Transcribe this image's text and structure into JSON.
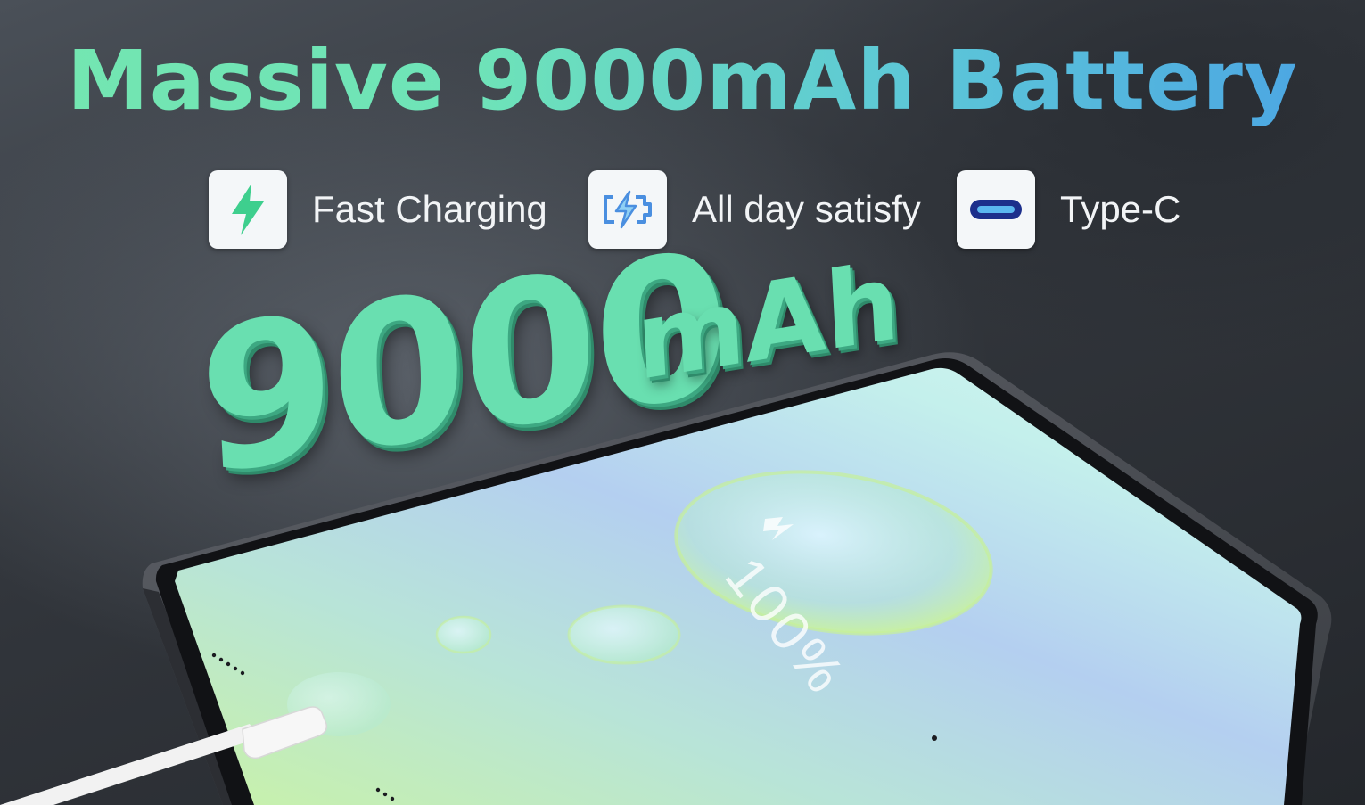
{
  "headline": {
    "prefix": "Massive 9000mAh",
    "suffix": "Battery"
  },
  "features": [
    {
      "icon": "lightning-icon",
      "label": "Fast Charging"
    },
    {
      "icon": "battery-charging-icon",
      "label": "All day satisfy"
    },
    {
      "icon": "usb-type-c-icon",
      "label": "Type-C"
    }
  ],
  "big_number": {
    "value": "9000",
    "unit": "mAh"
  },
  "screen": {
    "battery_level": "100%"
  },
  "colors": {
    "accent_green": "#69dfb0",
    "accent_blue": "#4aa2e4",
    "background": "#2a2e33"
  }
}
